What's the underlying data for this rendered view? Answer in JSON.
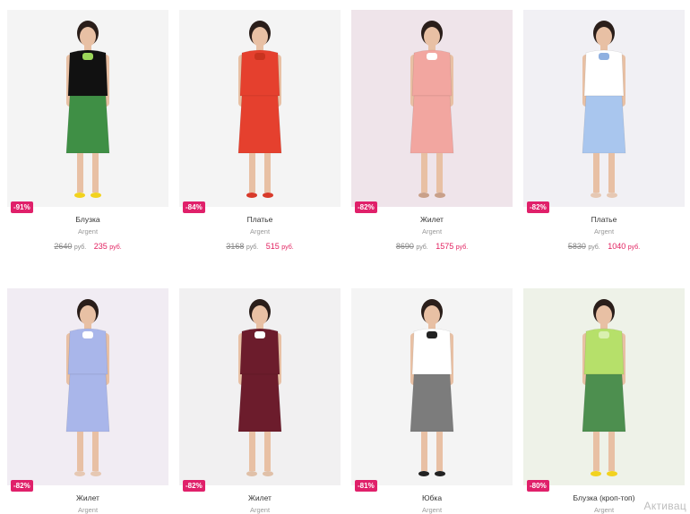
{
  "currency": "руб.",
  "products": [
    {
      "name": "Блузка",
      "brand": "Argent",
      "discount": "-91%",
      "old_price": "2640",
      "new_price": "235",
      "colors": {
        "bg": "#f4f4f4",
        "top": "#111111",
        "bottom": "#3f8f45",
        "accent": "#9bd65a",
        "shoes": "#f2d21e"
      }
    },
    {
      "name": "Платье",
      "brand": "Argent",
      "discount": "-84%",
      "old_price": "3168",
      "new_price": "515",
      "colors": {
        "bg": "#f4f4f4",
        "top": "#e5402e",
        "bottom": "#e5402e",
        "accent": "#c9331f",
        "shoes": "#d83a2a"
      }
    },
    {
      "name": "Жилет",
      "brand": "Argent",
      "discount": "-82%",
      "old_price": "8690",
      "new_price": "1575",
      "colors": {
        "bg": "#efe4ea",
        "top": "#f2a6a0",
        "bottom": "#f2a6a0",
        "accent": "#ffffff",
        "shoes": "#c9a089"
      }
    },
    {
      "name": "Платье",
      "brand": "Argent",
      "discount": "-82%",
      "old_price": "5830",
      "new_price": "1040",
      "colors": {
        "bg": "#f1f0f4",
        "top": "#ffffff",
        "bottom": "#a9c6ee",
        "accent": "#8fb0e0",
        "shoes": "#e6c8b3"
      }
    },
    {
      "name": "Жилет",
      "brand": "Argent",
      "discount": "-82%",
      "colors": {
        "bg": "#f1ecf3",
        "top": "#a9b6ea",
        "bottom": "#a9b6ea",
        "accent": "#ffffff",
        "shoes": "#e6c8b3"
      }
    },
    {
      "name": "Жилет",
      "brand": "Argent",
      "discount": "-82%",
      "colors": {
        "bg": "#f1f0f1",
        "top": "#6c1c2c",
        "bottom": "#6c1c2c",
        "accent": "#ffffff",
        "shoes": "#e0c0a8"
      }
    },
    {
      "name": "Юбка",
      "brand": "Argent",
      "discount": "-81%",
      "colors": {
        "bg": "#f4f4f4",
        "top": "#ffffff",
        "bottom": "#7c7c7c",
        "accent": "#222222",
        "shoes": "#222222"
      }
    },
    {
      "name": "Блузка (кроп-топ)",
      "brand": "Argent",
      "discount": "-80%",
      "colors": {
        "bg": "#eef2e8",
        "top": "#b6e06a",
        "bottom": "#4d8f4f",
        "accent": "#d9f0b0",
        "shoes": "#f2d21e"
      }
    }
  ],
  "watermark": "Активац"
}
